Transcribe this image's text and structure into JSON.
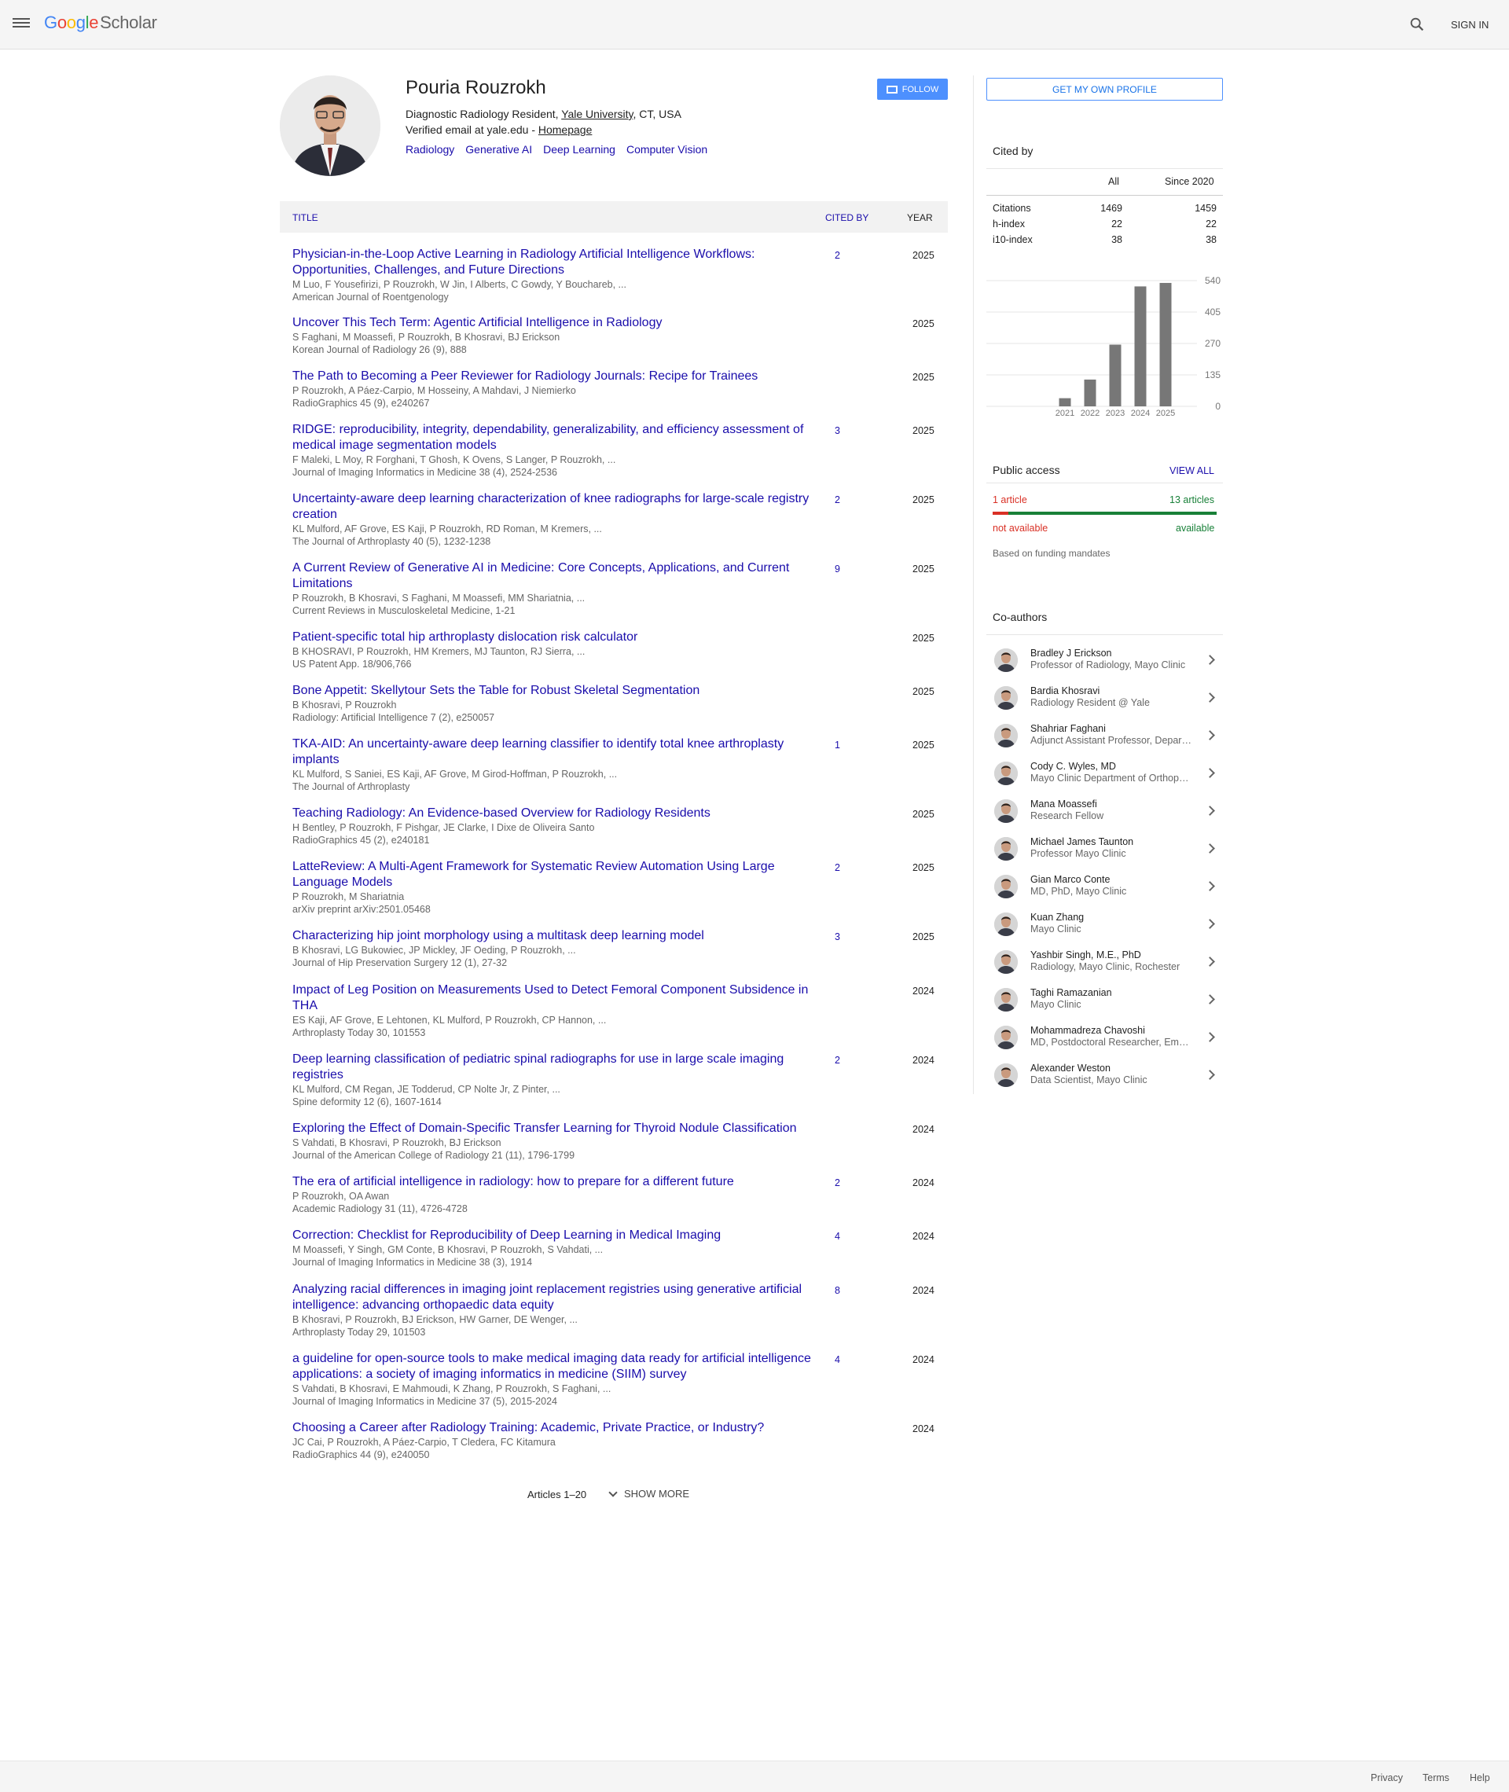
{
  "header": {
    "logo_google": [
      "G",
      "o",
      "o",
      "g",
      "l",
      "e"
    ],
    "logo_colors": [
      "#4285f4",
      "#ea4335",
      "#fbbc05",
      "#4285f4",
      "#34a853",
      "#ea4335"
    ],
    "logo_scholar": "Scholar",
    "sign_in": "SIGN IN"
  },
  "profile": {
    "name": "Pouria Rouzrokh",
    "affiliation_prefix": "Diagnostic Radiology Resident, ",
    "affiliation_link": "Yale University",
    "affiliation_suffix": ", CT, USA",
    "email_prefix": "Verified email at yale.edu - ",
    "homepage": "Homepage",
    "interests": [
      "Radiology",
      "Generative AI",
      "Deep Learning",
      "Computer Vision"
    ],
    "follow": "FOLLOW"
  },
  "table": {
    "col_title": "TITLE",
    "col_cited": "CITED BY",
    "col_year": "YEAR",
    "articles": [
      {
        "title": "Physician-in-the-Loop Active Learning in Radiology Artificial Intelligence Workflows: Opportunities, Challenges, and Future Directions",
        "authors": "M Luo, F Yousefirizi, P Rouzrokh, W Jin, I Alberts, C Gowdy, Y Bouchareb, ...",
        "venue": "American Journal of Roentgenology",
        "cited": "2",
        "year": "2025"
      },
      {
        "title": "Uncover This Tech Term: Agentic Artificial Intelligence in Radiology",
        "authors": "S Faghani, M Moassefi, P Rouzrokh, B Khosravi, BJ Erickson",
        "venue": "Korean Journal of Radiology 26 (9), 888",
        "cited": "",
        "year": "2025"
      },
      {
        "title": "The Path to Becoming a Peer Reviewer for Radiology Journals: Recipe for Trainees",
        "authors": "P Rouzrokh, A Páez-Carpio, M Hosseiny, A Mahdavi, J Niemierko",
        "venue": "RadioGraphics 45 (9), e240267",
        "cited": "",
        "year": "2025"
      },
      {
        "title": "RIDGE: reproducibility, integrity, dependability, generalizability, and efficiency assessment of medical image segmentation models",
        "authors": "F Maleki, L Moy, R Forghani, T Ghosh, K Ovens, S Langer, P Rouzrokh, ...",
        "venue": "Journal of Imaging Informatics in Medicine 38 (4), 2524-2536",
        "cited": "3",
        "year": "2025"
      },
      {
        "title": "Uncertainty-aware deep learning characterization of knee radiographs for large-scale registry creation",
        "authors": "KL Mulford, AF Grove, ES Kaji, P Rouzrokh, RD Roman, M Kremers, ...",
        "venue": "The Journal of Arthroplasty 40 (5), 1232-1238",
        "cited": "2",
        "year": "2025"
      },
      {
        "title": "A Current Review of Generative AI in Medicine: Core Concepts, Applications, and Current Limitations",
        "authors": "P Rouzrokh, B Khosravi, S Faghani, M Moassefi, MM Shariatnia, ...",
        "venue": "Current Reviews in Musculoskeletal Medicine, 1-21",
        "cited": "9",
        "year": "2025"
      },
      {
        "title": "Patient-specific total hip arthroplasty dislocation risk calculator",
        "authors": "B KHOSRAVI, P Rouzrokh, HM Kremers, MJ Taunton, RJ Sierra, ...",
        "venue": "US Patent App. 18/906,766",
        "cited": "",
        "year": "2025"
      },
      {
        "title": "Bone Appetit: Skellytour Sets the Table for Robust Skeletal Segmentation",
        "authors": "B Khosravi, P Rouzrokh",
        "venue": "Radiology: Artificial Intelligence 7 (2), e250057",
        "cited": "",
        "year": "2025"
      },
      {
        "title": "TKA-AID: An uncertainty-aware deep learning classifier to identify total knee arthroplasty implants",
        "authors": "KL Mulford, S Saniei, ES Kaji, AF Grove, M Girod-Hoffman, P Rouzrokh, ...",
        "venue": "The Journal of Arthroplasty",
        "cited": "1",
        "year": "2025"
      },
      {
        "title": "Teaching Radiology: An Evidence-based Overview for Radiology Residents",
        "authors": "H Bentley, P Rouzrokh, F Pishgar, JE Clarke, I Dixe de Oliveira Santo",
        "venue": "RadioGraphics 45 (2), e240181",
        "cited": "",
        "year": "2025"
      },
      {
        "title": "LatteReview: A Multi-Agent Framework for Systematic Review Automation Using Large Language Models",
        "authors": "P Rouzrokh, M Shariatnia",
        "venue": "arXiv preprint arXiv:2501.05468",
        "cited": "2",
        "year": "2025"
      },
      {
        "title": "Characterizing hip joint morphology using a multitask deep learning model",
        "authors": "B Khosravi, LG Bukowiec, JP Mickley, JF Oeding, P Rouzrokh, ...",
        "venue": "Journal of Hip Preservation Surgery 12 (1), 27-32",
        "cited": "3",
        "year": "2025"
      },
      {
        "title": "Impact of Leg Position on Measurements Used to Detect Femoral Component Subsidence in THA",
        "authors": "ES Kaji, AF Grove, E Lehtonen, KL Mulford, P Rouzrokh, CP Hannon, ...",
        "venue": "Arthroplasty Today 30, 101553",
        "cited": "",
        "year": "2024"
      },
      {
        "title": "Deep learning classification of pediatric spinal radiographs for use in large scale imaging registries",
        "authors": "KL Mulford, CM Regan, JE Todderud, CP Nolte Jr, Z Pinter, ...",
        "venue": "Spine deformity 12 (6), 1607-1614",
        "cited": "2",
        "year": "2024"
      },
      {
        "title": "Exploring the Effect of Domain-Specific Transfer Learning for Thyroid Nodule Classification",
        "authors": "S Vahdati, B Khosravi, P Rouzrokh, BJ Erickson",
        "venue": "Journal of the American College of Radiology 21 (11), 1796-1799",
        "cited": "",
        "year": "2024"
      },
      {
        "title": "The era of artificial intelligence in radiology: how to prepare for a different future",
        "authors": "P Rouzrokh, OA Awan",
        "venue": "Academic Radiology 31 (11), 4726-4728",
        "cited": "2",
        "year": "2024"
      },
      {
        "title": "Correction: Checklist for Reproducibility of Deep Learning in Medical Imaging",
        "authors": "M Moassefi, Y Singh, GM Conte, B Khosravi, P Rouzrokh, S Vahdati, ...",
        "venue": "Journal of Imaging Informatics in Medicine 38 (3), 1914",
        "cited": "4",
        "year": "2024"
      },
      {
        "title": "Analyzing racial differences in imaging joint replacement registries using generative artificial intelligence: advancing orthopaedic data equity",
        "authors": "B Khosravi, P Rouzrokh, BJ Erickson, HW Garner, DE Wenger, ...",
        "venue": "Arthroplasty Today 29, 101503",
        "cited": "8",
        "year": "2024"
      },
      {
        "title": "a guideline for open-source tools to make medical imaging data ready for artificial intelligence applications: a society of imaging informatics in medicine (SIIM) survey",
        "authors": "S Vahdati, B Khosravi, E Mahmoudi, K Zhang, P Rouzrokh, S Faghani, ...",
        "venue": "Journal of Imaging Informatics in Medicine 37 (5), 2015-2024",
        "cited": "4",
        "year": "2024"
      },
      {
        "title": "Choosing a Career after Radiology Training: Academic, Private Practice, or Industry?",
        "authors": "JC Cai, P Rouzrokh, A Páez-Carpio, T Cledera, FC Kitamura",
        "venue": "RadioGraphics 44 (9), e240050",
        "cited": "",
        "year": "2024"
      }
    ],
    "articles_count": "Articles 1–20",
    "show_more": "SHOW MORE"
  },
  "sidebar": {
    "get_profile": "GET MY OWN PROFILE",
    "cited_by": {
      "title": "Cited by",
      "col_all": "All",
      "col_since": "Since 2020",
      "rows": [
        {
          "label": "Citations",
          "all": "1469",
          "since": "1459"
        },
        {
          "label": "h-index",
          "all": "22",
          "since": "22"
        },
        {
          "label": "i10-index",
          "all": "38",
          "since": "38"
        }
      ]
    },
    "public_access": {
      "title": "Public access",
      "view_all": "VIEW ALL",
      "left_count": "1 article",
      "right_count": "13 articles",
      "left_label": "not available",
      "right_label": "available",
      "note": "Based on funding mandates",
      "not_available_fraction": 0.071
    },
    "coauthors_title": "Co-authors",
    "coauthors": [
      {
        "name": "Bradley J Erickson",
        "aff": "Professor of Radiology, Mayo Clinic"
      },
      {
        "name": "Bardia Khosravi",
        "aff": "Radiology Resident @ Yale"
      },
      {
        "name": "Shahriar Faghani",
        "aff": "Adjunct Assistant Professor, Department of Radiology"
      },
      {
        "name": "Cody C. Wyles, MD",
        "aff": "Mayo Clinic Department of Orthopedic Surgery"
      },
      {
        "name": "Mana Moassefi",
        "aff": "Research Fellow"
      },
      {
        "name": "Michael James Taunton",
        "aff": "Professor Mayo Clinic"
      },
      {
        "name": "Gian Marco Conte",
        "aff": "MD, PhD, Mayo Clinic"
      },
      {
        "name": "Kuan Zhang",
        "aff": "Mayo Clinic"
      },
      {
        "name": "Yashbir Singh, M.E., PhD",
        "aff": "Radiology, Mayo Clinic, Rochester"
      },
      {
        "name": "Taghi Ramazanian",
        "aff": "Mayo Clinic"
      },
      {
        "name": "Mohammadreza Chavoshi",
        "aff": "MD, Postdoctoral Researcher, Emory University"
      },
      {
        "name": "Alexander Weston",
        "aff": "Data Scientist, Mayo Clinic"
      }
    ]
  },
  "chart_data": {
    "type": "bar",
    "categories": [
      "2021",
      "2022",
      "2023",
      "2024",
      "2025"
    ],
    "values": [
      35,
      115,
      265,
      515,
      530
    ],
    "ylim": [
      0,
      540
    ],
    "yticks": [
      "540",
      "405",
      "270",
      "135",
      "0"
    ],
    "bar_color": "#777777",
    "grid": true
  },
  "footer": {
    "privacy": "Privacy",
    "terms": "Terms",
    "help": "Help"
  }
}
